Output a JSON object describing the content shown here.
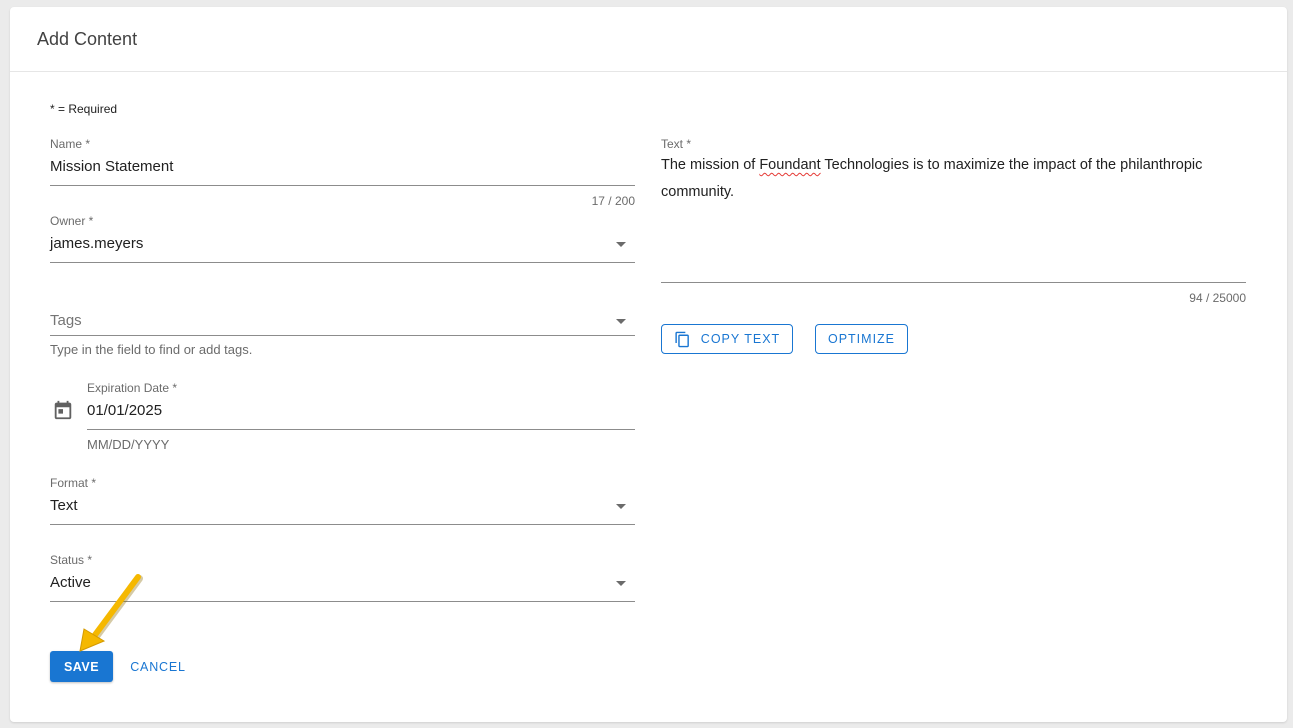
{
  "page": {
    "title": "Add Content",
    "required_note": "* = Required"
  },
  "form": {
    "name": {
      "label": "Name *",
      "value": "Mission Statement",
      "counter": "17 / 200"
    },
    "owner": {
      "label": "Owner *",
      "value": "james.meyers"
    },
    "tags": {
      "placeholder": "Tags",
      "hint": "Type in the field to find or add tags."
    },
    "expiration": {
      "label": "Expiration Date *",
      "value": "01/01/2025",
      "hint": "MM/DD/YYYY"
    },
    "format": {
      "label": "Format *",
      "value": "Text"
    },
    "status": {
      "label": "Status *",
      "value": "Active"
    },
    "text": {
      "label": "Text *",
      "value_before": "The mission of ",
      "value_misspelled": "Foundant",
      "value_after": " Technologies is to maximize the impact of the philanthropic community.",
      "counter": "94 / 25000"
    }
  },
  "buttons": {
    "copy_text": "COPY TEXT",
    "optimize": "OPTIMIZE",
    "save": "SAVE",
    "cancel": "CANCEL"
  },
  "colors": {
    "primary": "#1976d2",
    "arrow": "#f5b800"
  },
  "icons": {
    "calendar": "calendar-icon",
    "copy": "copy-icon",
    "dropdown": "chevron-down-icon"
  }
}
